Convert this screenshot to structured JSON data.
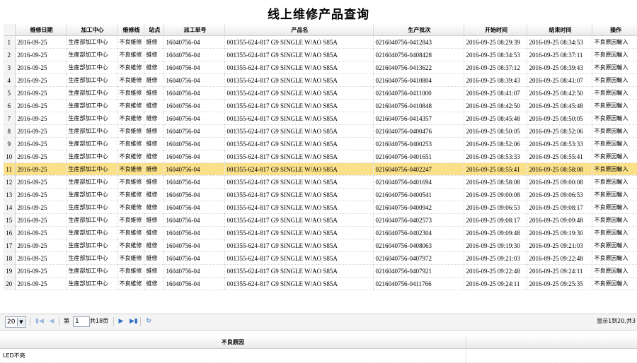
{
  "page": {
    "title": "线上维修产品查询"
  },
  "grid": {
    "columns": [
      "维修日期",
      "加工中心",
      "维修线",
      "站点",
      "派工单号",
      "产品名",
      "生产批次",
      "开始时间",
      "结束时间",
      "操作"
    ],
    "selected_row": 11,
    "rows": [
      {
        "n": "1",
        "date": "2016-09-25",
        "center": "生産部加工中心",
        "line": "不良維修",
        "station": "維修",
        "order": "16040756-04",
        "product": "001355-624-817 G9 SINGLE W/AO S85A",
        "batch": "0216040756-0412843",
        "start": "2016-09-25 08:29:39",
        "end": "2016-09-25 08:34:53",
        "op": "不良原因輸入"
      },
      {
        "n": "2",
        "date": "2016-09-25",
        "center": "生産部加工中心",
        "line": "不良維修",
        "station": "維修",
        "order": "16040756-04",
        "product": "001355-624-817 G9 SINGLE W/AO S85A",
        "batch": "0216040756-0408428",
        "start": "2016-09-25 08:34:53",
        "end": "2016-09-25 08:37:11",
        "op": "不良原因輸入"
      },
      {
        "n": "3",
        "date": "2016-09-25",
        "center": "生産部加工中心",
        "line": "不良維修",
        "station": "維修",
        "order": "16040756-04",
        "product": "001355-624-817 G9 SINGLE W/AO S85A",
        "batch": "0216040756-0413622",
        "start": "2016-09-25 08:37:12",
        "end": "2016-09-25 08:39:43",
        "op": "不良原因輸入"
      },
      {
        "n": "4",
        "date": "2016-09-25",
        "center": "生産部加工中心",
        "line": "不良維修",
        "station": "維修",
        "order": "16040756-04",
        "product": "001355-624-817 G9 SINGLE W/AO S85A",
        "batch": "0216040756-0410804",
        "start": "2016-09-25 08:39:43",
        "end": "2016-09-25 08:41:07",
        "op": "不良原因輸入"
      },
      {
        "n": "5",
        "date": "2016-09-25",
        "center": "生産部加工中心",
        "line": "不良維修",
        "station": "維修",
        "order": "16040756-04",
        "product": "001355-624-817 G9 SINGLE W/AO S85A",
        "batch": "0216040756-0411000",
        "start": "2016-09-25 08:41:07",
        "end": "2016-09-25 08:42:50",
        "op": "不良原因輸入"
      },
      {
        "n": "6",
        "date": "2016-09-25",
        "center": "生産部加工中心",
        "line": "不良維修",
        "station": "維修",
        "order": "16040756-04",
        "product": "001355-624-817 G9 SINGLE W/AO S85A",
        "batch": "0216040756-0410848",
        "start": "2016-09-25 08:42:50",
        "end": "2016-09-25 08:45:48",
        "op": "不良原因輸入"
      },
      {
        "n": "7",
        "date": "2016-09-25",
        "center": "生産部加工中心",
        "line": "不良維修",
        "station": "維修",
        "order": "16040756-04",
        "product": "001355-624-817 G9 SINGLE W/AO S85A",
        "batch": "0216040756-0414357",
        "start": "2016-09-25 08:45:48",
        "end": "2016-09-25 08:50:05",
        "op": "不良原因輸入"
      },
      {
        "n": "8",
        "date": "2016-09-25",
        "center": "生産部加工中心",
        "line": "不良維修",
        "station": "維修",
        "order": "16040756-04",
        "product": "001355-624-817 G9 SINGLE W/AO S85A",
        "batch": "0216040756-0400476",
        "start": "2016-09-25 08:50:05",
        "end": "2016-09-25 08:52:06",
        "op": "不良原因輸入"
      },
      {
        "n": "9",
        "date": "2016-09-25",
        "center": "生産部加工中心",
        "line": "不良維修",
        "station": "維修",
        "order": "16040756-04",
        "product": "001355-624-817 G9 SINGLE W/AO S85A",
        "batch": "0216040756-0400253",
        "start": "2016-09-25 08:52:06",
        "end": "2016-09-25 08:53:33",
        "op": "不良原因輸入"
      },
      {
        "n": "10",
        "date": "2016-09-25",
        "center": "生産部加工中心",
        "line": "不良維修",
        "station": "維修",
        "order": "16040756-04",
        "product": "001355-624-817 G9 SINGLE W/AO S85A",
        "batch": "0216040756-0401651",
        "start": "2016-09-25 08:53:33",
        "end": "2016-09-25 08:55:41",
        "op": "不良原因輸入"
      },
      {
        "n": "11",
        "date": "2016-09-25",
        "center": "生産部加工中心",
        "line": "不良維修",
        "station": "維修",
        "order": "16040756-04",
        "product": "001355-624-817 G9 SINGLE W/AO S85A",
        "batch": "0216040756-0402247",
        "start": "2016-09-25 08:55:41",
        "end": "2016-09-25 08:58:08",
        "op": "不良原因輸入"
      },
      {
        "n": "12",
        "date": "2016-09-25",
        "center": "生産部加工中心",
        "line": "不良維修",
        "station": "維修",
        "order": "16040756-04",
        "product": "001355-624-817 G9 SINGLE W/AO S85A",
        "batch": "0216040756-0401694",
        "start": "2016-09-25 08:58:08",
        "end": "2016-09-25 09:00:08",
        "op": "不良原因輸入"
      },
      {
        "n": "13",
        "date": "2016-09-25",
        "center": "生産部加工中心",
        "line": "不良維修",
        "station": "維修",
        "order": "16040756-04",
        "product": "001355-624-817 G9 SINGLE W/AO S85A",
        "batch": "0216040756-0400541",
        "start": "2016-09-25 09:00:08",
        "end": "2016-09-25 09:06:53",
        "op": "不良原因輸入"
      },
      {
        "n": "14",
        "date": "2016-09-25",
        "center": "生産部加工中心",
        "line": "不良維修",
        "station": "維修",
        "order": "16040756-04",
        "product": "001355-624-817 G9 SINGLE W/AO S85A",
        "batch": "0216040756-0400942",
        "start": "2016-09-25 09:06:53",
        "end": "2016-09-25 09:08:17",
        "op": "不良原因輸入"
      },
      {
        "n": "15",
        "date": "2016-09-25",
        "center": "生産部加工中心",
        "line": "不良維修",
        "station": "維修",
        "order": "16040756-04",
        "product": "001355-624-817 G9 SINGLE W/AO S85A",
        "batch": "0216040756-0402573",
        "start": "2016-09-25 09:08:17",
        "end": "2016-09-25 09:09:48",
        "op": "不良原因輸入"
      },
      {
        "n": "16",
        "date": "2016-09-25",
        "center": "生産部加工中心",
        "line": "不良維修",
        "station": "維修",
        "order": "16040756-04",
        "product": "001355-624-817 G9 SINGLE W/AO S85A",
        "batch": "0216040756-0402304",
        "start": "2016-09-25 09:09:48",
        "end": "2016-09-25 09:19:30",
        "op": "不良原因輸入"
      },
      {
        "n": "17",
        "date": "2016-09-25",
        "center": "生産部加工中心",
        "line": "不良維修",
        "station": "維修",
        "order": "16040756-04",
        "product": "001355-624-817 G9 SINGLE W/AO S85A",
        "batch": "0216040756-0408063",
        "start": "2016-09-25 09:19:30",
        "end": "2016-09-25 09:21:03",
        "op": "不良原因輸入"
      },
      {
        "n": "18",
        "date": "2016-09-25",
        "center": "生産部加工中心",
        "line": "不良維修",
        "station": "維修",
        "order": "16040756-04",
        "product": "001355-624-817 G9 SINGLE W/AO S85A",
        "batch": "0216040756-0407972",
        "start": "2016-09-25 09:21:03",
        "end": "2016-09-25 09:22:48",
        "op": "不良原因輸入"
      },
      {
        "n": "19",
        "date": "2016-09-25",
        "center": "生産部加工中心",
        "line": "不良維修",
        "station": "維修",
        "order": "16040756-04",
        "product": "001355-624-817 G9 SINGLE W/AO S85A",
        "batch": "0216040756-0407921",
        "start": "2016-09-25 09:22:48",
        "end": "2016-09-25 09:24:11",
        "op": "不良原因輸入"
      },
      {
        "n": "20",
        "date": "2016-09-25",
        "center": "生産部加工中心",
        "line": "不良維修",
        "station": "維修",
        "order": "16040756-04",
        "product": "001355-624-817 G9 SINGLE W/AO S85A",
        "batch": "0216040756-0411766",
        "start": "2016-09-25 09:24:11",
        "end": "2016-09-25 09:25:35",
        "op": "不良原因輸入"
      }
    ]
  },
  "pager": {
    "page_size": "20",
    "page_prefix": "第",
    "page_value": "1",
    "page_total": "共18页",
    "display_info": "显示1到20,共3"
  },
  "detail": {
    "header": "不良原因",
    "value": "LED不亮"
  },
  "colors": {
    "selected_row": "#fbe08a",
    "pager_icon": "#2f6fc5"
  }
}
